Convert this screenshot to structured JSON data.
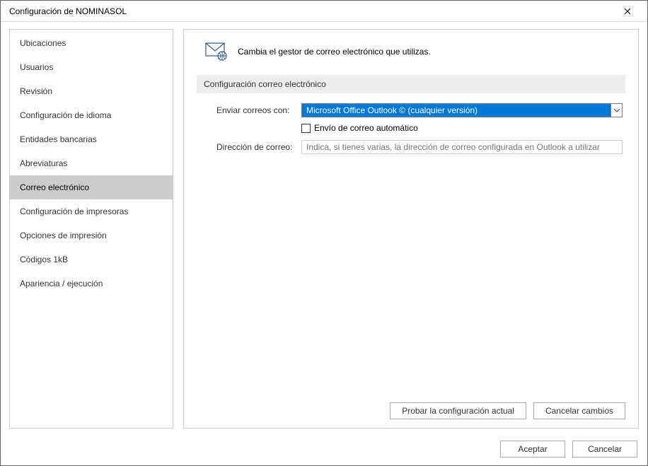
{
  "window": {
    "title": "Configuración de NOMINASOL"
  },
  "sidebar": {
    "items": [
      {
        "label": "Ubicaciones"
      },
      {
        "label": "Usuarios"
      },
      {
        "label": "Revisión"
      },
      {
        "label": "Configuración de idioma"
      },
      {
        "label": "Entidades bancarias"
      },
      {
        "label": "Abreviaturas"
      },
      {
        "label": "Correo electrónico"
      },
      {
        "label": "Configuración de impresoras"
      },
      {
        "label": "Opciones de impresión"
      },
      {
        "label": "Códigos 1kB"
      },
      {
        "label": "Apariencia / ejecución"
      }
    ],
    "selectedIndex": 6
  },
  "header": {
    "text": "Cambia el gestor de correo electrónico que utilizas."
  },
  "section": {
    "title": "Configuración correo electrónico",
    "sendWithLabel": "Enviar correos con:",
    "sendWithValue": "Microsoft Office Outlook © (cualquier versión)",
    "autoSendLabel": "Envío de correo automático",
    "autoSendChecked": false,
    "emailLabel": "Dirección de correo:",
    "emailPlaceholder": "Indica, si tienes varias, la dirección de correo configurada en Outlook a utilizar",
    "emailValue": ""
  },
  "contentButtons": {
    "test": "Probar la configuración actual",
    "cancelChanges": "Cancelar cambios"
  },
  "footer": {
    "ok": "Aceptar",
    "cancel": "Cancelar"
  }
}
